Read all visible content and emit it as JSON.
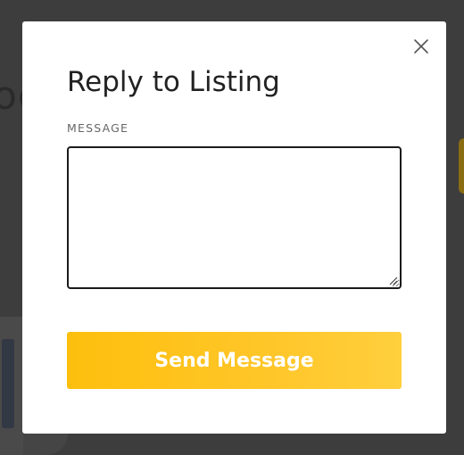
{
  "background": {
    "partial_text": "oc"
  },
  "modal": {
    "title": "Reply to Listing",
    "message_label": "MESSAGE",
    "message_value": "",
    "send_label": "Send Message",
    "close_icon": "close-icon"
  },
  "colors": {
    "accent": "#fdbf0d",
    "overlay": "#3d3d3d",
    "modal_bg": "#ffffff",
    "input_border": "#1b1b1b"
  }
}
